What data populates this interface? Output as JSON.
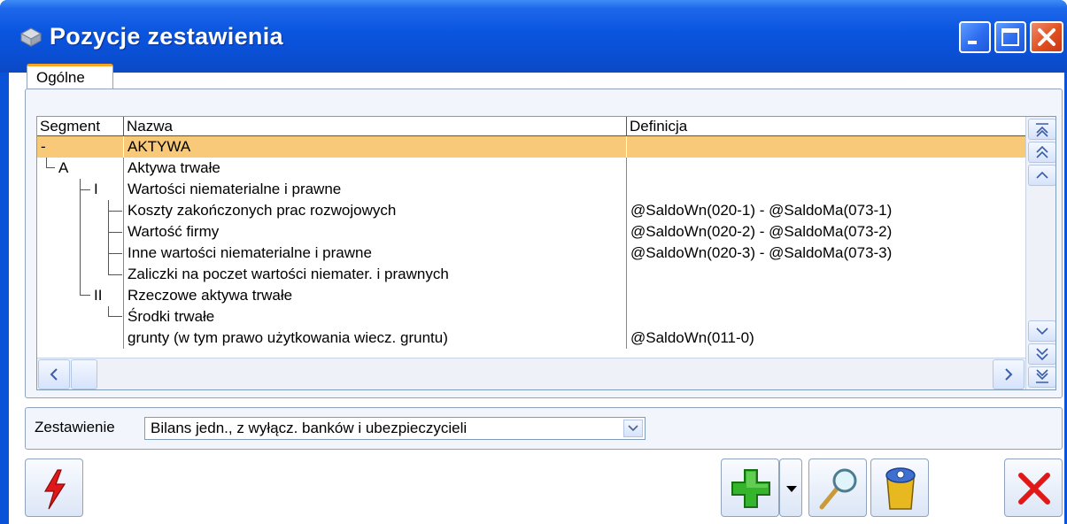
{
  "window": {
    "title": "Pozycje zestawienia"
  },
  "tabs": [
    {
      "label": "Ogólne",
      "active": true
    }
  ],
  "grid": {
    "columns": [
      "Segment",
      "Nazwa",
      "Definicja"
    ],
    "rows": [
      {
        "segment": "-",
        "name": "AKTYWA",
        "definition": "",
        "selected": true
      },
      {
        "segment": "A",
        "name": "Aktywa trwałe",
        "definition": ""
      },
      {
        "segment": "I",
        "name": "Wartości niematerialne i prawne",
        "definition": ""
      },
      {
        "segment": "",
        "name": "Koszty zakończonych prac rozwojowych",
        "definition": "@SaldoWn(020-1) - @SaldoMa(073-1)"
      },
      {
        "segment": "",
        "name": "Wartość firmy",
        "definition": "@SaldoWn(020-2) - @SaldoMa(073-2)"
      },
      {
        "segment": "",
        "name": "Inne wartości niematerialne i prawne",
        "definition": "@SaldoWn(020-3) - @SaldoMa(073-3)"
      },
      {
        "segment": "",
        "name": "Zaliczki na poczet wartości niemater. i prawnych",
        "definition": ""
      },
      {
        "segment": "II",
        "name": "Rzeczowe aktywa trwałe",
        "definition": ""
      },
      {
        "segment": "",
        "name": "Środki trwałe",
        "definition": ""
      },
      {
        "segment": "",
        "name": "grunty (w tym prawo użytkowania wiecz. gruntu)",
        "definition": "@SaldoWn(011-0)"
      }
    ]
  },
  "summary": {
    "label": "Zestawienie",
    "selected": "Bilans jedn., z wyłącz. banków i ubezpieczycieli"
  },
  "toolbar": {
    "icons": [
      "lightning-icon",
      "plus-icon",
      "dropdown-arrow-icon",
      "magnifier-icon",
      "trash-bin-icon",
      "close-x-icon"
    ]
  },
  "colors": {
    "titlebar": "#0a55df",
    "selected_row": "#f9c97a",
    "tab_accent": "#f5a623"
  }
}
